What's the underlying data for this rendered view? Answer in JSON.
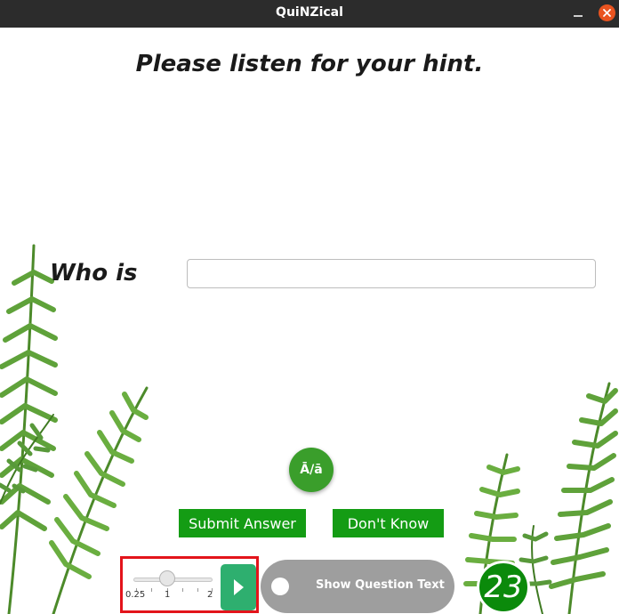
{
  "window": {
    "title": "QuiNZical"
  },
  "question": {
    "hint_text": "Please listen for your hint.",
    "prompt_label": "Who is",
    "answer_value": "",
    "answer_placeholder": ""
  },
  "controls": {
    "macron_button": "Ā/ā",
    "submit_label": "Submit Answer",
    "dont_know_label": "Don't Know"
  },
  "speed": {
    "ticks": [
      "0.25",
      "1",
      "2"
    ],
    "value": 1,
    "min": 0.25,
    "max": 2
  },
  "toggle": {
    "label": "Show Question Text",
    "on": false
  },
  "timer": {
    "value": "23"
  },
  "colors": {
    "titlebar": "#2c2c2c",
    "close": "#e95420",
    "button_green": "#149c14",
    "play": "#2eaf6f",
    "highlight": "#e3141b",
    "toggle_bg": "#9e9e9e"
  },
  "icons": {
    "minimize": "minimize-icon",
    "close": "close-icon",
    "play": "play-icon"
  }
}
